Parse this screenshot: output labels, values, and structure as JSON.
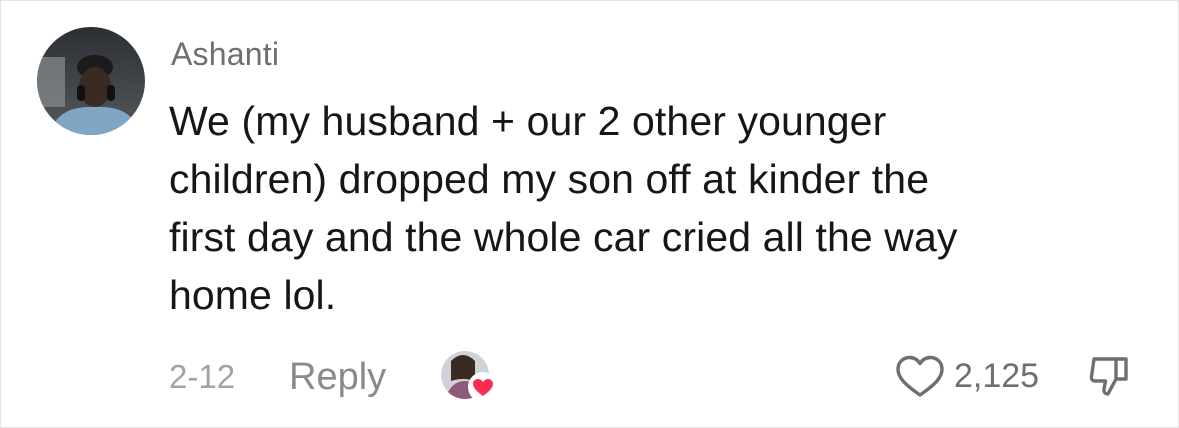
{
  "comment": {
    "username": "Ashanti",
    "text_lines": [
      "We (my husband + our 2 other younger",
      "children) dropped my son off at kinder the",
      "first day and the whole car cried all the way",
      "home lol."
    ],
    "date": "2-12",
    "reply_label": "Reply",
    "like_count": "2,125",
    "icons": {
      "avatar": "user-avatar",
      "creator_liked": "creator-liked-heart-icon",
      "like": "heart-outline-icon",
      "dislike": "thumbs-down-icon"
    },
    "colors": {
      "username": "#6f6f6f",
      "text": "#161616",
      "meta": "#a3a3a3",
      "heart_badge": "#fe2c55"
    }
  }
}
